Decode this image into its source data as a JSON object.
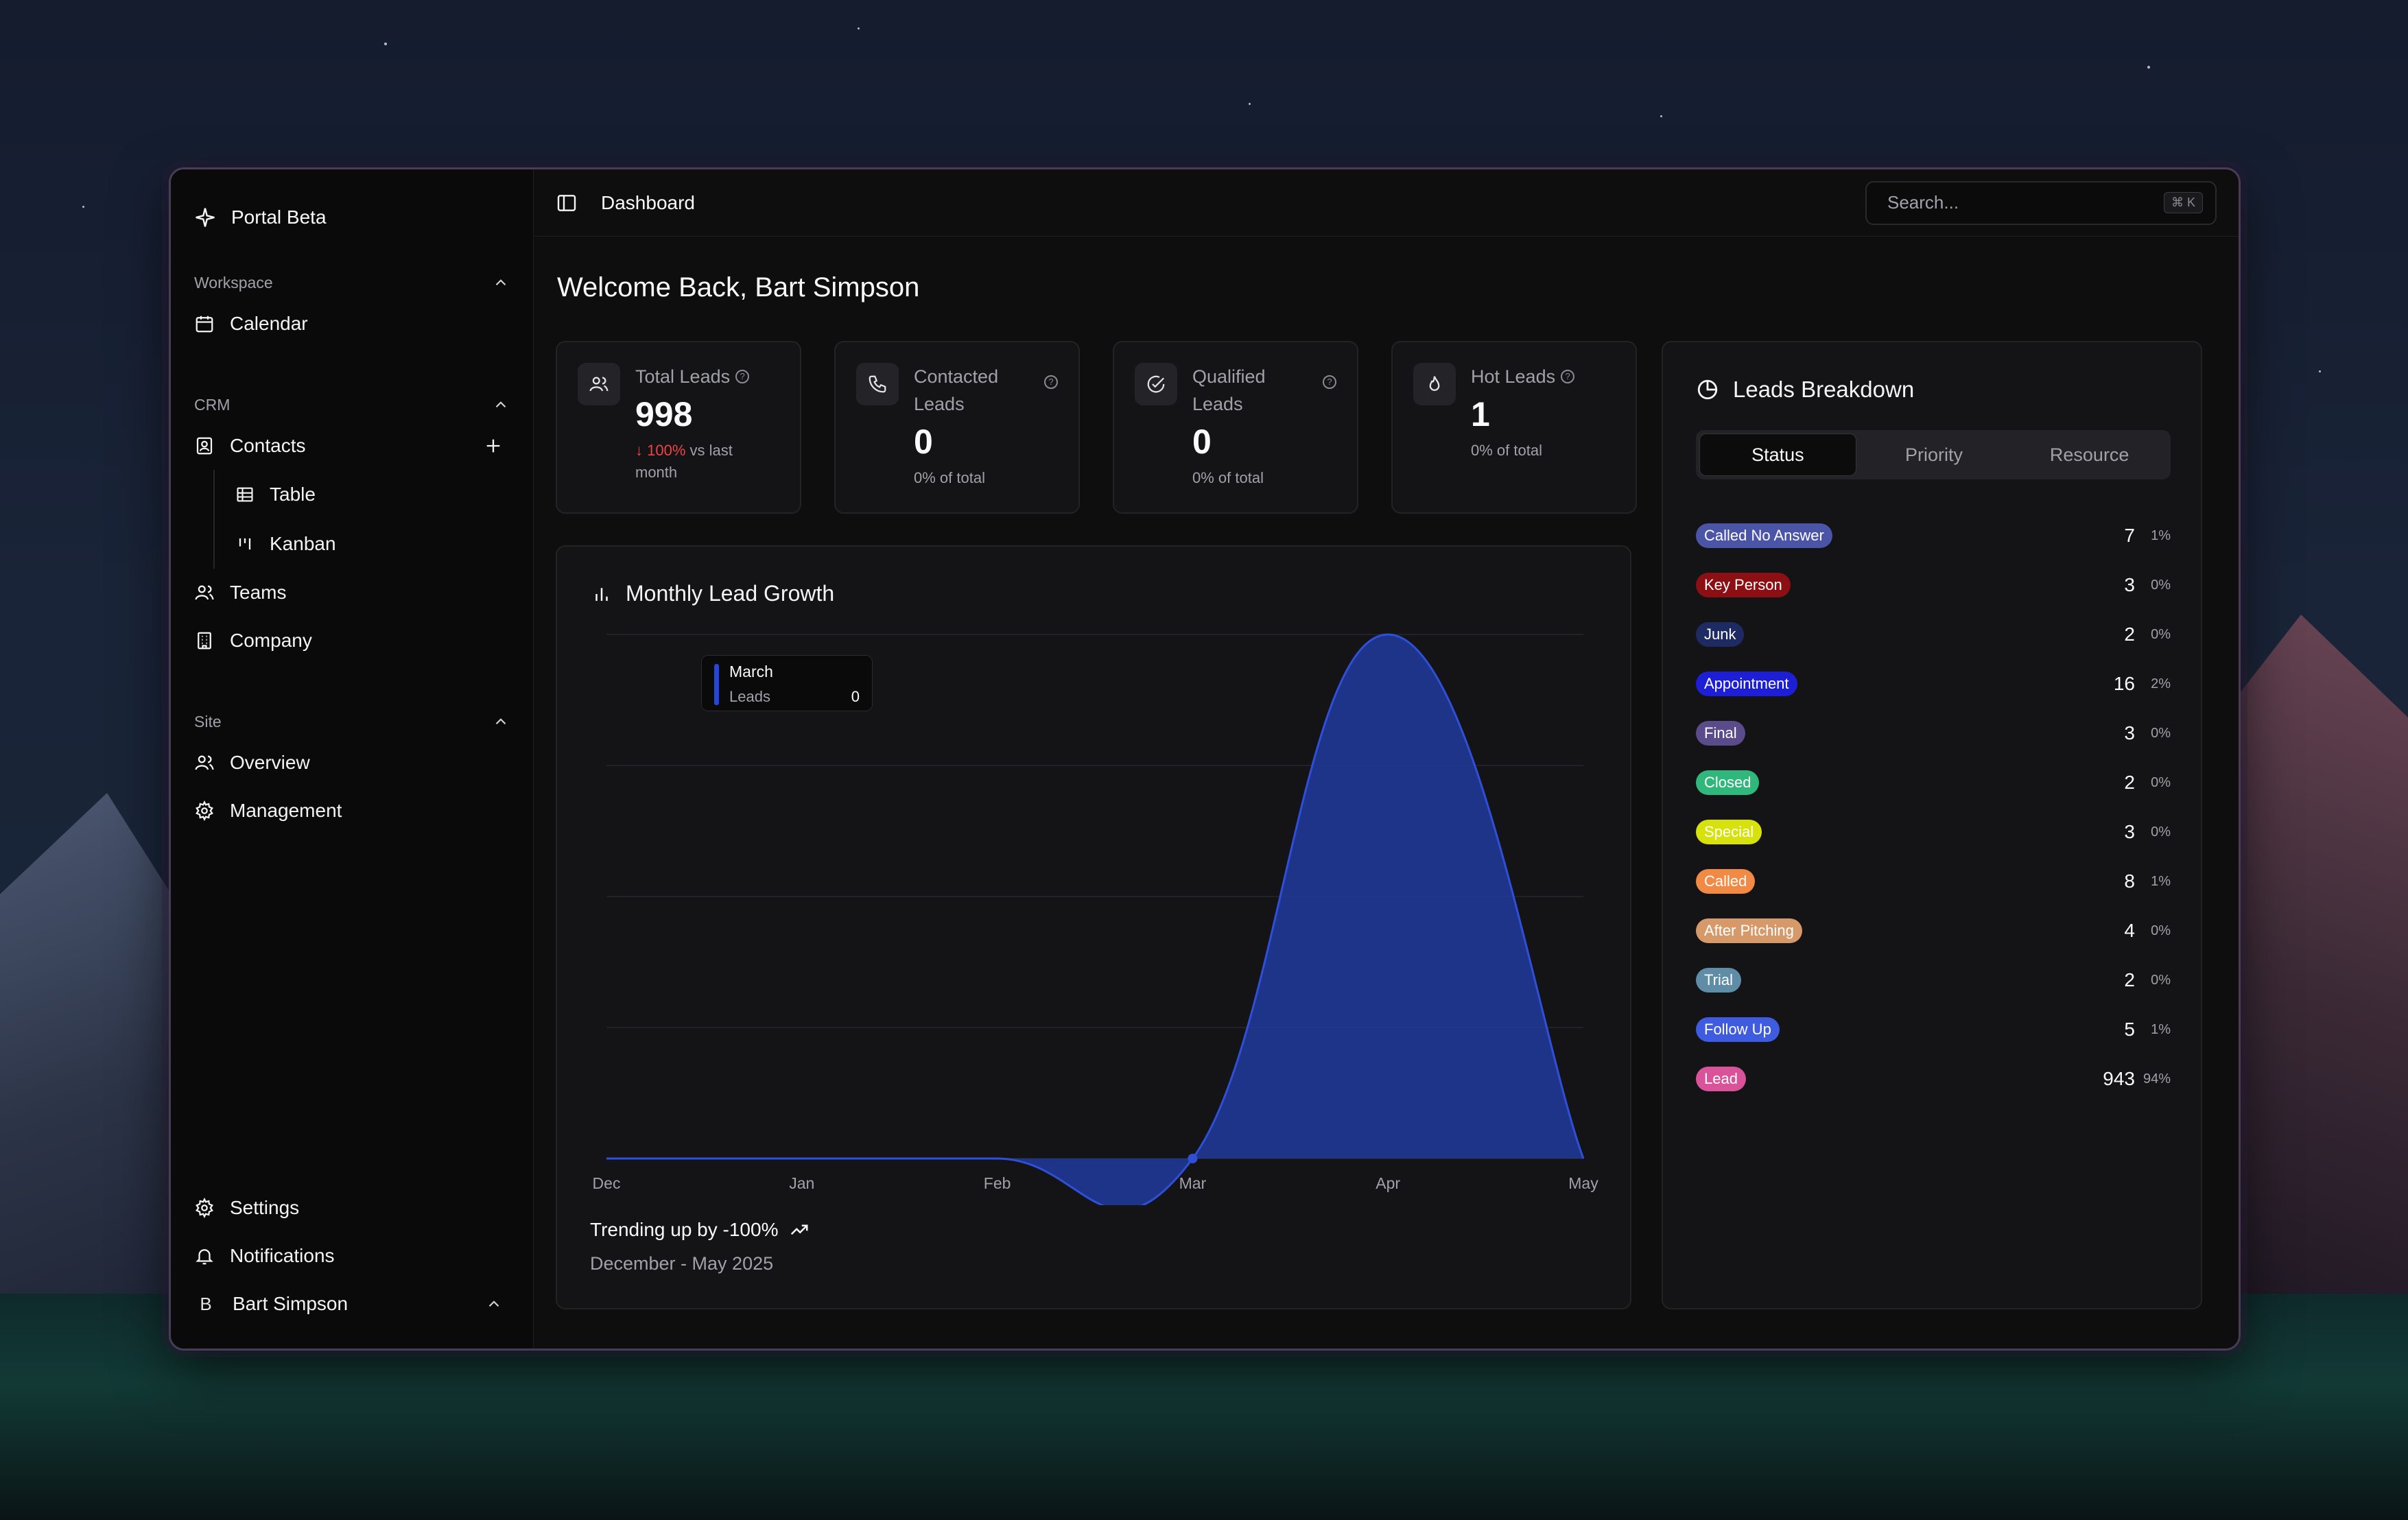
{
  "app": {
    "title": "Portal Beta"
  },
  "sidebar": {
    "workspace_label": "Workspace",
    "calendar": "Calendar",
    "crm_label": "CRM",
    "contacts": "Contacts",
    "table": "Table",
    "kanban": "Kanban",
    "teams": "Teams",
    "company": "Company",
    "site_label": "Site",
    "overview": "Overview",
    "management": "Management",
    "settings": "Settings",
    "notifications": "Notifications",
    "user_initial": "B",
    "user_name": "Bart Simpson"
  },
  "topbar": {
    "breadcrumb": "Dashboard",
    "search_placeholder": "Search...",
    "shortcut": "⌘ K"
  },
  "welcome": "Welcome Back, Bart Simpson",
  "stats": {
    "total": {
      "title": "Total Leads",
      "value": "998",
      "change": "100%",
      "change_suffix": "vs last month"
    },
    "contacted": {
      "title": "Contacted Leads",
      "value": "0",
      "sub": "0% of total"
    },
    "qualified": {
      "title": "Qualified Leads",
      "value": "0",
      "sub": "0% of total"
    },
    "hot": {
      "title": "Hot Leads",
      "value": "1",
      "sub": "0% of total"
    }
  },
  "chart": {
    "title": "Monthly Lead Growth",
    "tooltip_month": "March",
    "tooltip_label": "Leads",
    "tooltip_value": "0",
    "trend_text": "Trending up by -100%",
    "range": "December - May 2025"
  },
  "chart_data": {
    "type": "area",
    "categories": [
      "Dec",
      "Jan",
      "Feb",
      "Mar",
      "Apr",
      "May"
    ],
    "values": [
      0,
      0,
      0,
      0,
      998,
      0
    ],
    "ylim": [
      0,
      998
    ],
    "grid": true,
    "color": "#1e3a9e"
  },
  "breakdown": {
    "title": "Leads Breakdown",
    "tabs": [
      "Status",
      "Priority",
      "Resource"
    ],
    "rows": [
      {
        "label": "Called No Answer",
        "count": "7",
        "pct": "1%",
        "color": "#4b55a8"
      },
      {
        "label": "Key Person",
        "count": "3",
        "pct": "0%",
        "color": "#8b0f13"
      },
      {
        "label": "Junk",
        "count": "2",
        "pct": "0%",
        "color": "#1e2b63"
      },
      {
        "label": "Appointment",
        "count": "16",
        "pct": "2%",
        "color": "#1d1fd6"
      },
      {
        "label": "Final",
        "count": "3",
        "pct": "0%",
        "color": "#5b4b8a"
      },
      {
        "label": "Closed",
        "count": "2",
        "pct": "0%",
        "color": "#2fb77c"
      },
      {
        "label": "Special",
        "count": "3",
        "pct": "0%",
        "color": "#d7e10b"
      },
      {
        "label": "Called",
        "count": "8",
        "pct": "1%",
        "color": "#f08a45"
      },
      {
        "label": "After Pitching",
        "count": "4",
        "pct": "0%",
        "color": "#d69a6a"
      },
      {
        "label": "Trial",
        "count": "2",
        "pct": "0%",
        "color": "#5f8ca6"
      },
      {
        "label": "Follow Up",
        "count": "5",
        "pct": "1%",
        "color": "#3f5be0"
      },
      {
        "label": "Lead",
        "count": "943",
        "pct": "94%",
        "color": "#d9539a"
      }
    ]
  }
}
